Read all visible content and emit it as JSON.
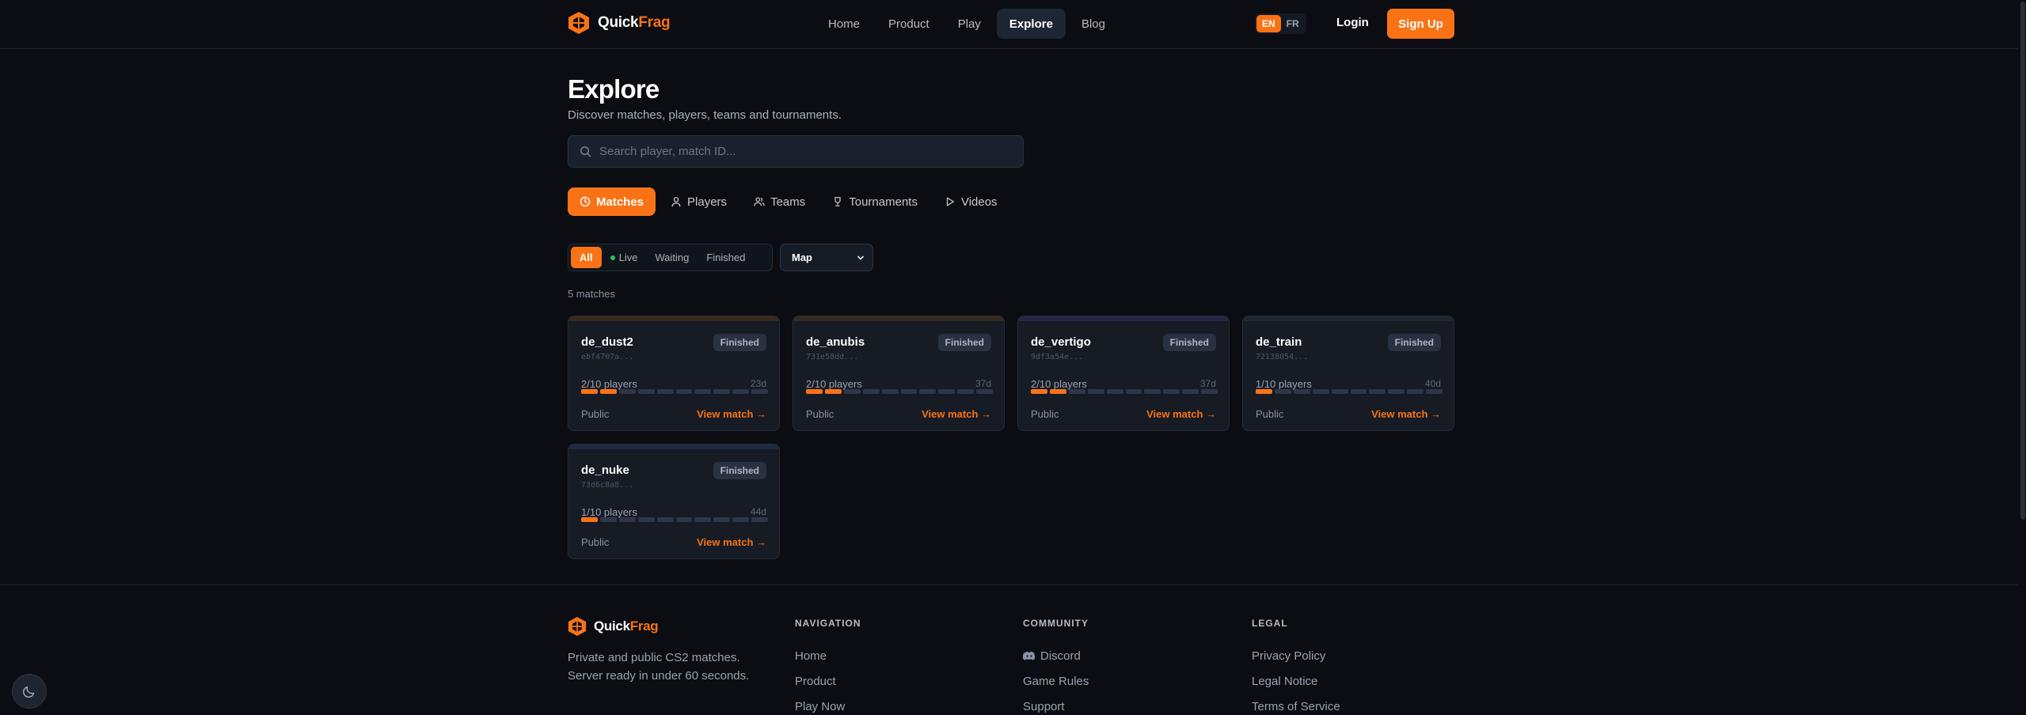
{
  "nav": {
    "brand_a": "Quick",
    "brand_b": "Frag",
    "links": [
      "Home",
      "Product",
      "Play",
      "Explore",
      "Blog"
    ],
    "active": "Explore",
    "lang": [
      "EN",
      "FR"
    ],
    "lang_active": "EN",
    "login": "Login",
    "signup": "Sign Up"
  },
  "header": {
    "title": "Explore",
    "subtitle": "Discover matches, players, teams and tournaments.",
    "search_placeholder": "Search player, match ID..."
  },
  "tabs": [
    {
      "label": "Matches",
      "icon": "clock-icon",
      "active": true
    },
    {
      "label": "Players",
      "icon": "user-icon"
    },
    {
      "label": "Teams",
      "icon": "users-icon"
    },
    {
      "label": "Tournaments",
      "icon": "trophy-icon"
    },
    {
      "label": "Videos",
      "icon": "play-icon"
    }
  ],
  "filters": {
    "status": [
      "All",
      "Live",
      "Waiting",
      "Finished"
    ],
    "status_active": "All",
    "map_select": "Map"
  },
  "results_count": "5 matches",
  "matches": [
    {
      "map": "de_dust2",
      "id": "ebf4707a...",
      "status": "Finished",
      "players": "2/10 players",
      "filled": 2,
      "total": 10,
      "age": "23d",
      "visibility": "Public",
      "action": "View match →",
      "band": "#3a2a1c"
    },
    {
      "map": "de_anubis",
      "id": "731e58dd...",
      "status": "Finished",
      "players": "2/10 players",
      "filled": 2,
      "total": 10,
      "age": "37d",
      "visibility": "Public",
      "action": "View match →",
      "band": "#352a20"
    },
    {
      "map": "de_vertigo",
      "id": "9df3a54e...",
      "status": "Finished",
      "players": "2/10 players",
      "filled": 2,
      "total": 10,
      "age": "37d",
      "visibility": "Public",
      "action": "View match →",
      "band": "#2c2446"
    },
    {
      "map": "de_train",
      "id": "72138054...",
      "status": "Finished",
      "players": "1/10 players",
      "filled": 1,
      "total": 10,
      "age": "40d",
      "visibility": "Public",
      "action": "View match →",
      "band": "#20262f"
    },
    {
      "map": "de_nuke",
      "id": "73d6c8a8...",
      "status": "Finished",
      "players": "1/10 players",
      "filled": 1,
      "total": 10,
      "age": "44d",
      "visibility": "Public",
      "action": "View match →",
      "band": "#1f2a44"
    }
  ],
  "footer": {
    "tagline_1": "Private and public CS2 matches.",
    "tagline_2": "Server ready in under 60 seconds.",
    "navigation_title": "NAVIGATION",
    "navigation": [
      "Home",
      "Product",
      "Play Now"
    ],
    "community_title": "COMMUNITY",
    "community": [
      "Discord",
      "Game Rules",
      "Support"
    ],
    "legal_title": "LEGAL",
    "legal": [
      "Privacy Policy",
      "Legal Notice",
      "Terms of Service"
    ]
  },
  "colors": {
    "accent": "#f97316",
    "background": "#0b0d12",
    "card": "#161b24",
    "live": "#22c55e"
  }
}
